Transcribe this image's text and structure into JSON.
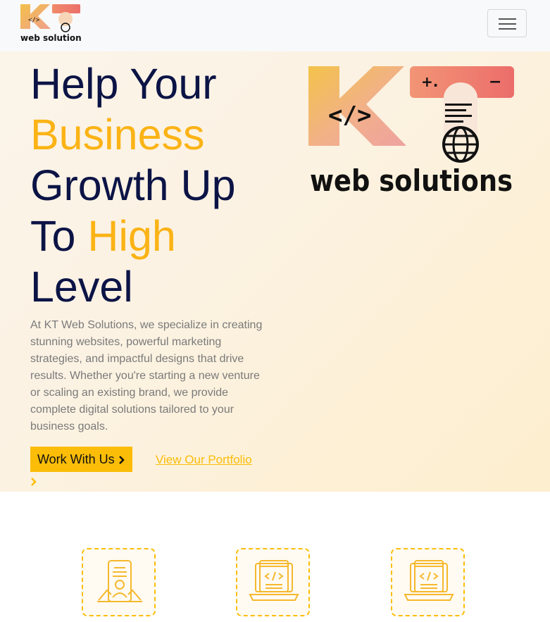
{
  "navbar": {
    "logo_text": "web solutions",
    "logo_alt": "KT Web Solutions logo",
    "menu_toggle_label": "Toggle navigation"
  },
  "hero": {
    "headline": {
      "line1": "Help Your",
      "line2": "Business",
      "line3": "Growth Up",
      "line4_a": "To ",
      "line4_b": "High",
      "line5": "Level"
    },
    "description": "At KT Web Solutions, we specialize in creating stunning websites, powerful marketing strategies, and impactful designs that drive results. Whether you're starting a new venture or scaling an existing brand, we provide complete digital solutions tailored to your business goals.",
    "primary_button": "Work With Us",
    "secondary_link": "View Our Portfolio",
    "logo": {
      "mark": "KT",
      "wordmark": "web solutions",
      "code_glyph": "</>",
      "plus": "+.",
      "minus": "−"
    }
  },
  "services": [
    {
      "icon": "mobile-app-icon"
    },
    {
      "icon": "laptop-code-icon"
    },
    {
      "icon": "laptop-code-icon"
    }
  ],
  "colors": {
    "navy": "#0c1446",
    "accent": "#fbb315",
    "button": "#fbbd08",
    "text_muted": "#7a7a7a"
  }
}
